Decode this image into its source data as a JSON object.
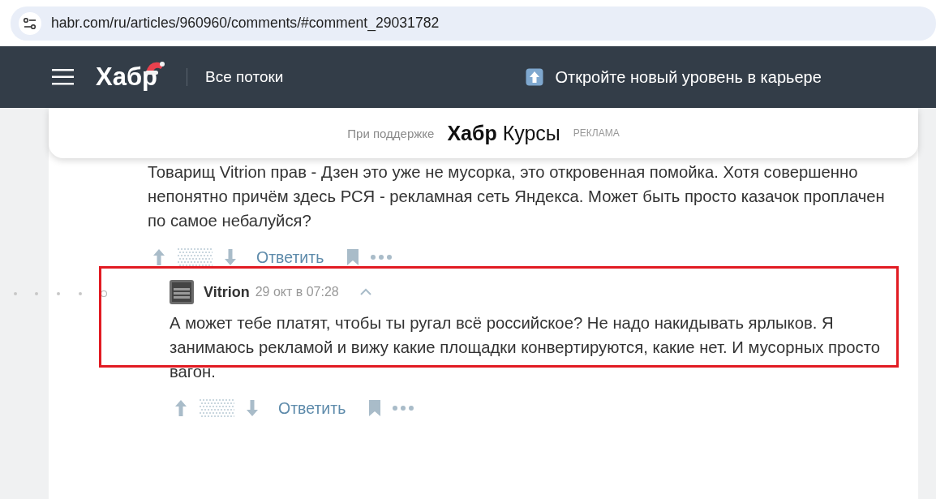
{
  "address_bar": {
    "url": "habr.com/ru/articles/960960/comments/#comment_29031782"
  },
  "header": {
    "logo": "Хабр",
    "nav": "Все потоки",
    "promo": "Откройте новый уровень в карьере"
  },
  "sponsor": {
    "label": "При поддержке",
    "brand_bold": "Хабр",
    "brand": "Курсы",
    "ad_label": "РЕКЛАМА"
  },
  "comments": [
    {
      "highlighted": false,
      "text": "Товарищ Vitrion прав - Дзен это уже не мусорка, это откровенная помойка. Хотя совершенно непонятно причём здесь РСЯ - рекламная сеть Яндекса. Может быть просто казачок проплачен по самое небалуйся?",
      "reply": "Ответить"
    },
    {
      "author": "Vitrion",
      "date": "29 окт в 07:28",
      "highlighted": true,
      "text": "А может тебе платят, чтобы ты ругал всё российское? Не надо накидывать ярлыков. Я занимаюсь рекламой и вижу какие площадки конвертируются, какие нет. И мусорных просто вагон.",
      "reply": "Ответить"
    }
  ]
}
